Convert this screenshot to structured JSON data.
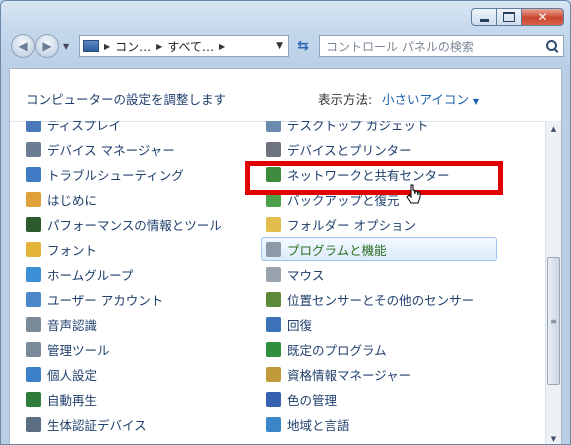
{
  "window": {
    "close_label": "✕"
  },
  "nav": {
    "back_glyph": "◀",
    "forward_glyph": "▶",
    "address": [
      "コン…",
      "すべて…"
    ],
    "search_placeholder": "コントロール パネルの検索"
  },
  "header": {
    "title": "コンピューターの設定を調整します",
    "view_label": "表示方法:",
    "view_value": "小さいアイコン"
  },
  "items": {
    "left": [
      {
        "label": "ディスプレイ",
        "icon": "display-icon"
      },
      {
        "label": "デバイス マネージャー",
        "icon": "device-manager-icon"
      },
      {
        "label": "トラブルシューティング",
        "icon": "troubleshooting-icon"
      },
      {
        "label": "はじめに",
        "icon": "getting-started-icon"
      },
      {
        "label": "パフォーマンスの情報とツール",
        "icon": "performance-icon"
      },
      {
        "label": "フォント",
        "icon": "fonts-icon"
      },
      {
        "label": "ホームグループ",
        "icon": "homegroup-icon"
      },
      {
        "label": "ユーザー アカウント",
        "icon": "user-accounts-icon"
      },
      {
        "label": "音声認識",
        "icon": "speech-recognition-icon"
      },
      {
        "label": "管理ツール",
        "icon": "admin-tools-icon"
      },
      {
        "label": "個人設定",
        "icon": "personalization-icon"
      },
      {
        "label": "自動再生",
        "icon": "autoplay-icon"
      },
      {
        "label": "生体認証デバイス",
        "icon": "biometric-icon"
      }
    ],
    "right": [
      {
        "label": "デスクトップ ガジェット",
        "icon": "gadgets-icon"
      },
      {
        "label": "デバイスとプリンター",
        "icon": "devices-printers-icon"
      },
      {
        "label": "ネットワークと共有センター",
        "icon": "network-icon"
      },
      {
        "label": "バックアップと復元",
        "icon": "backup-icon"
      },
      {
        "label": "フォルダー オプション",
        "icon": "folder-options-icon"
      },
      {
        "label": "プログラムと機能",
        "icon": "programs-icon",
        "selected": true
      },
      {
        "label": "マウス",
        "icon": "mouse-icon"
      },
      {
        "label": "位置センサーとその他のセンサー",
        "icon": "sensor-icon"
      },
      {
        "label": "回復",
        "icon": "recovery-icon"
      },
      {
        "label": "既定のプログラム",
        "icon": "default-programs-icon"
      },
      {
        "label": "資格情報マネージャー",
        "icon": "credential-icon"
      },
      {
        "label": "色の管理",
        "icon": "color-management-icon"
      },
      {
        "label": "地域と言語",
        "icon": "region-language-icon"
      }
    ]
  },
  "colors": {
    "link": "#1e3f6b",
    "selected_text": "#2a6e21",
    "highlight": "#e00000"
  }
}
